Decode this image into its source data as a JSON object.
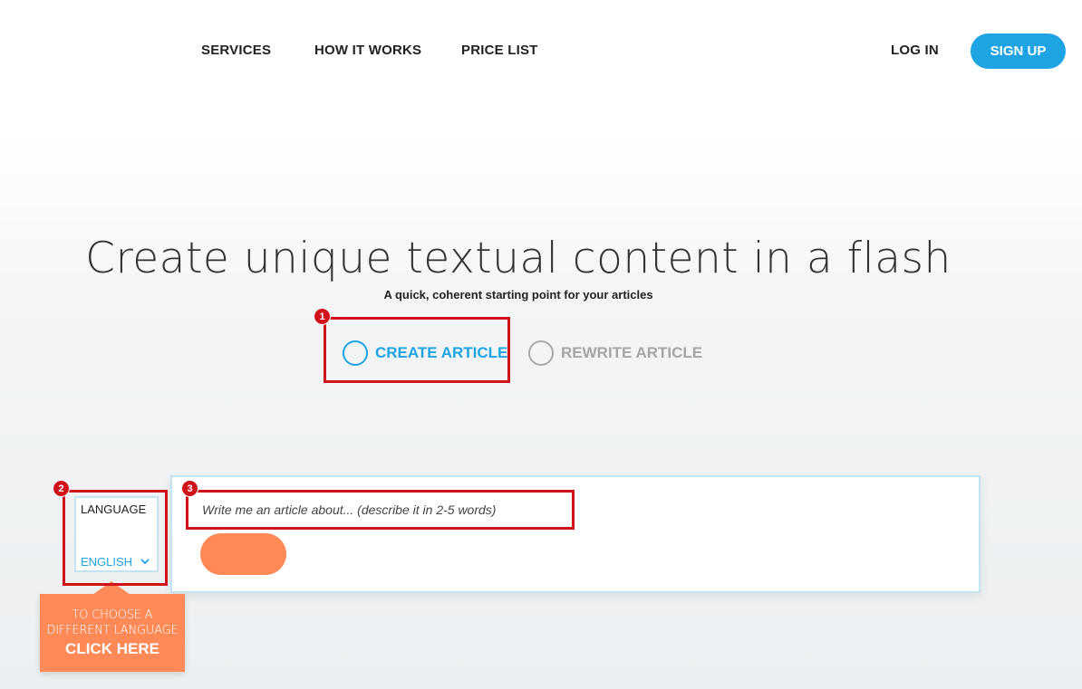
{
  "nav": {
    "links": [
      "SERVICES",
      "HOW IT WORKS",
      "PRICE LIST"
    ],
    "login": "LOG IN",
    "signup": "SIGN UP"
  },
  "hero": {
    "title": "Create unique textual content in a flash",
    "subtitle": "A quick, coherent starting point for your articles"
  },
  "mode": {
    "options": [
      "CREATE ARTICLE",
      "REWRITE ARTICLE"
    ],
    "selected": "CREATE ARTICLE"
  },
  "annotations": [
    "1",
    "2",
    "3"
  ],
  "language": {
    "label": "LANGUAGE",
    "value": "ENGLISH"
  },
  "topic": {
    "placeholder": "Write me an article about... (describe it in 2-5 words)",
    "value": ""
  },
  "tooltip": {
    "line1": "TO CHOOSE A",
    "line2": "DIFFERENT LANGUAGE",
    "cta": "CLICK HERE"
  },
  "colors": {
    "accent": "#1ea4e3",
    "cta": "#ff8a57",
    "annotation": "#d0131a"
  }
}
